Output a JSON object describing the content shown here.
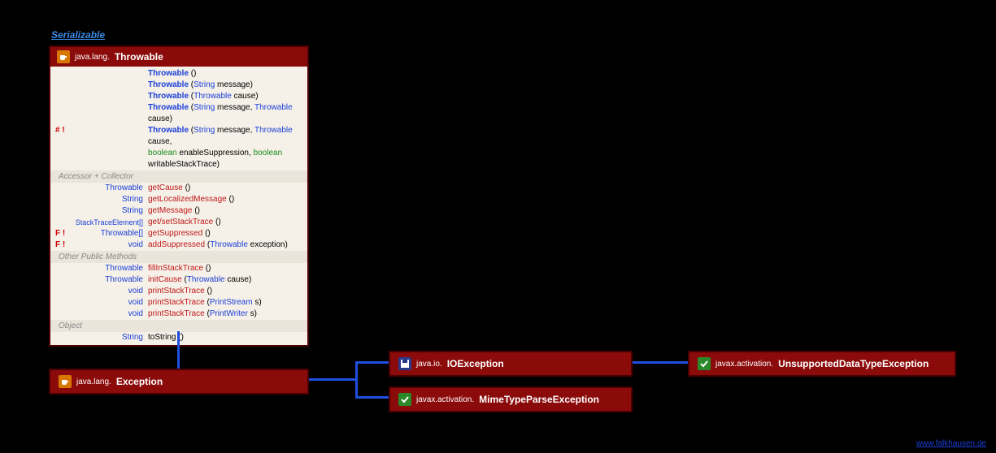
{
  "interface": {
    "label": "Serializable"
  },
  "throwable": {
    "pkg": "java.lang.",
    "cls": "Throwable",
    "ctors": [
      {
        "mod": "",
        "text": "Throwable ()"
      },
      {
        "mod": "",
        "text": "Throwable (String message)"
      },
      {
        "mod": "",
        "text": "Throwable (Throwable cause)"
      },
      {
        "mod": "",
        "text": "Throwable (String message, Throwable cause)"
      },
      {
        "mod": "# !",
        "text": "Throwable (String message, Throwable cause,"
      },
      {
        "mod": "",
        "text_cont": "boolean enableSuppression, boolean writableStackTrace)"
      }
    ],
    "sections": {
      "accessor": "Accessor + Collector",
      "other": "Other Public Methods",
      "object": "Object"
    },
    "accessor_rows": [
      {
        "mod": "",
        "ret": "Throwable",
        "name": "getCause",
        "args": "()"
      },
      {
        "mod": "",
        "ret": "String",
        "name": "getLocalizedMessage",
        "args": "()"
      },
      {
        "mod": "",
        "ret": "String",
        "name": "getMessage",
        "args": "()"
      },
      {
        "mod": "",
        "ret": "StackTraceElement[]",
        "name": "get/setStackTrace",
        "args": "()"
      },
      {
        "mod": "F !",
        "ret": "Throwable[]",
        "name": "getSuppressed",
        "args": "()"
      },
      {
        "mod": "F !",
        "ret": "void",
        "name": "addSuppressed",
        "args": "(Throwable exception)"
      }
    ],
    "other_rows": [
      {
        "mod": "",
        "ret": "Throwable",
        "name": "fillInStackTrace",
        "args": "()"
      },
      {
        "mod": "",
        "ret": "Throwable",
        "name": "initCause",
        "args": "(Throwable cause)"
      },
      {
        "mod": "",
        "ret": "void",
        "name": "printStackTrace",
        "args": "()"
      },
      {
        "mod": "",
        "ret": "void",
        "name": "printStackTrace",
        "args": "(PrintStream s)"
      },
      {
        "mod": "",
        "ret": "void",
        "name": "printStackTrace",
        "args": "(PrintWriter s)"
      }
    ],
    "object_rows": [
      {
        "mod": "",
        "ret": "String",
        "name": "toString",
        "args": "()"
      }
    ]
  },
  "exception": {
    "pkg": "java.lang.",
    "cls": "Exception"
  },
  "ioexception": {
    "pkg": "java.io.",
    "cls": "IOException"
  },
  "mimetype": {
    "pkg": "javax.activation.",
    "cls": "MimeTypeParseException"
  },
  "unsupported": {
    "pkg": "javax.activation.",
    "cls": "UnsupportedDataTypeException"
  },
  "footer": {
    "text": "www.falkhausen.de"
  },
  "chart_data": {
    "type": "diagram",
    "description": "Java class hierarchy UML diagram",
    "nodes": [
      {
        "id": "Serializable",
        "kind": "interface"
      },
      {
        "id": "java.lang.Throwable",
        "kind": "class",
        "implements": [
          "Serializable"
        ]
      },
      {
        "id": "java.lang.Exception",
        "kind": "class",
        "extends": "java.lang.Throwable"
      },
      {
        "id": "java.io.IOException",
        "kind": "class",
        "extends": "java.lang.Exception"
      },
      {
        "id": "javax.activation.MimeTypeParseException",
        "kind": "class",
        "extends": "java.lang.Exception"
      },
      {
        "id": "javax.activation.UnsupportedDataTypeException",
        "kind": "class",
        "extends": "java.io.IOException"
      }
    ],
    "edges": [
      [
        "java.lang.Throwable",
        "Serializable"
      ],
      [
        "java.lang.Exception",
        "java.lang.Throwable"
      ],
      [
        "java.io.IOException",
        "java.lang.Exception"
      ],
      [
        "javax.activation.MimeTypeParseException",
        "java.lang.Exception"
      ],
      [
        "javax.activation.UnsupportedDataTypeException",
        "java.io.IOException"
      ]
    ]
  }
}
